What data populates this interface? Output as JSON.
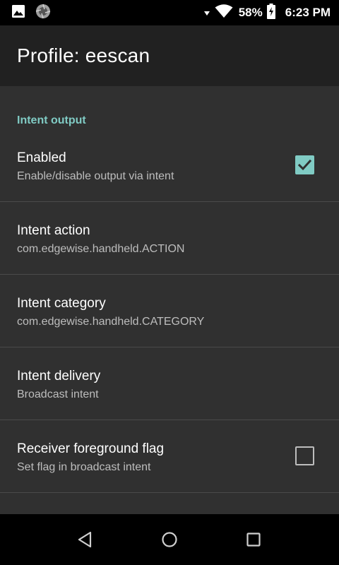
{
  "status_bar": {
    "battery_percent": "58%",
    "time": "6:23 PM",
    "icons": [
      "image-icon",
      "aperture-icon",
      "wifi-icon",
      "battery-charging-icon"
    ]
  },
  "app_bar": {
    "title": "Profile: eescan"
  },
  "category": {
    "title": "Intent output"
  },
  "preferences": [
    {
      "title": "Enabled",
      "summary": "Enable/disable output via intent",
      "checkbox": "checked"
    },
    {
      "title": "Intent action",
      "summary": "com.edgewise.handheld.ACTION"
    },
    {
      "title": "Intent category",
      "summary": "com.edgewise.handheld.CATEGORY"
    },
    {
      "title": "Intent delivery",
      "summary": "Broadcast intent"
    },
    {
      "title": "Receiver foreground flag",
      "summary": "Set flag in broadcast intent",
      "checkbox": "unchecked"
    }
  ],
  "colors": {
    "accent": "#80CBC4",
    "background": "#303030",
    "app_bar": "#212121",
    "status_bar": "#000000"
  },
  "nav_bar": {
    "icons": [
      "back-icon",
      "home-icon",
      "recents-icon"
    ]
  }
}
